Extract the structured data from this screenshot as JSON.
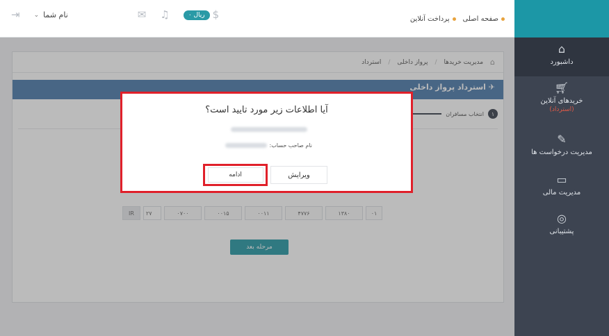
{
  "topbar": {
    "breadcrumb_home": "صفحه اصلی",
    "breadcrumb_online_payment": "پرداخت آنلاین",
    "user_label": "نام شما",
    "wallet_label": "۰ ریال",
    "currency_symbol": "$"
  },
  "sidebar": {
    "items": [
      {
        "label": "داشبورد",
        "icon": "home-icon",
        "active": true
      },
      {
        "label": "خریدهای آنلاین",
        "sub": "(استرداد)",
        "icon": "cart-icon"
      },
      {
        "label": "مدیریت درخواست ها",
        "icon": "edit-icon"
      },
      {
        "label": "مدیریت مالی",
        "icon": "money-icon"
      },
      {
        "label": "پشتیبانی",
        "icon": "lifebuoy-icon"
      }
    ]
  },
  "content": {
    "breadcrumb": [
      "مدیریت خریدها",
      "پرواز داخلی",
      "استرداد"
    ],
    "header_title": "استرداد پرواز داخلی",
    "step_number": "۱",
    "step_label": "انتخاب مسافران",
    "iban_prefix": "IR",
    "iban_input": "۲۷",
    "iban_parts": [
      "۰۷۰۰",
      "۰۰۱۵",
      "۰۰۱۱",
      "۴۷۷۶",
      "۱۳۸۰",
      "۰۱"
    ],
    "next_button": "مرحله بعد"
  },
  "modal": {
    "title": "آیا اطلاعات زیر مورد تایید است؟",
    "account_holder_label": "نام صاحب حساب:",
    "edit_button": "ویرایش",
    "continue_button": "ادامه"
  },
  "colors": {
    "accent": "#2a9aa6",
    "sidebar": "#3d4451",
    "header_blue": "#4f7dad",
    "highlight_red": "#e0202a"
  }
}
